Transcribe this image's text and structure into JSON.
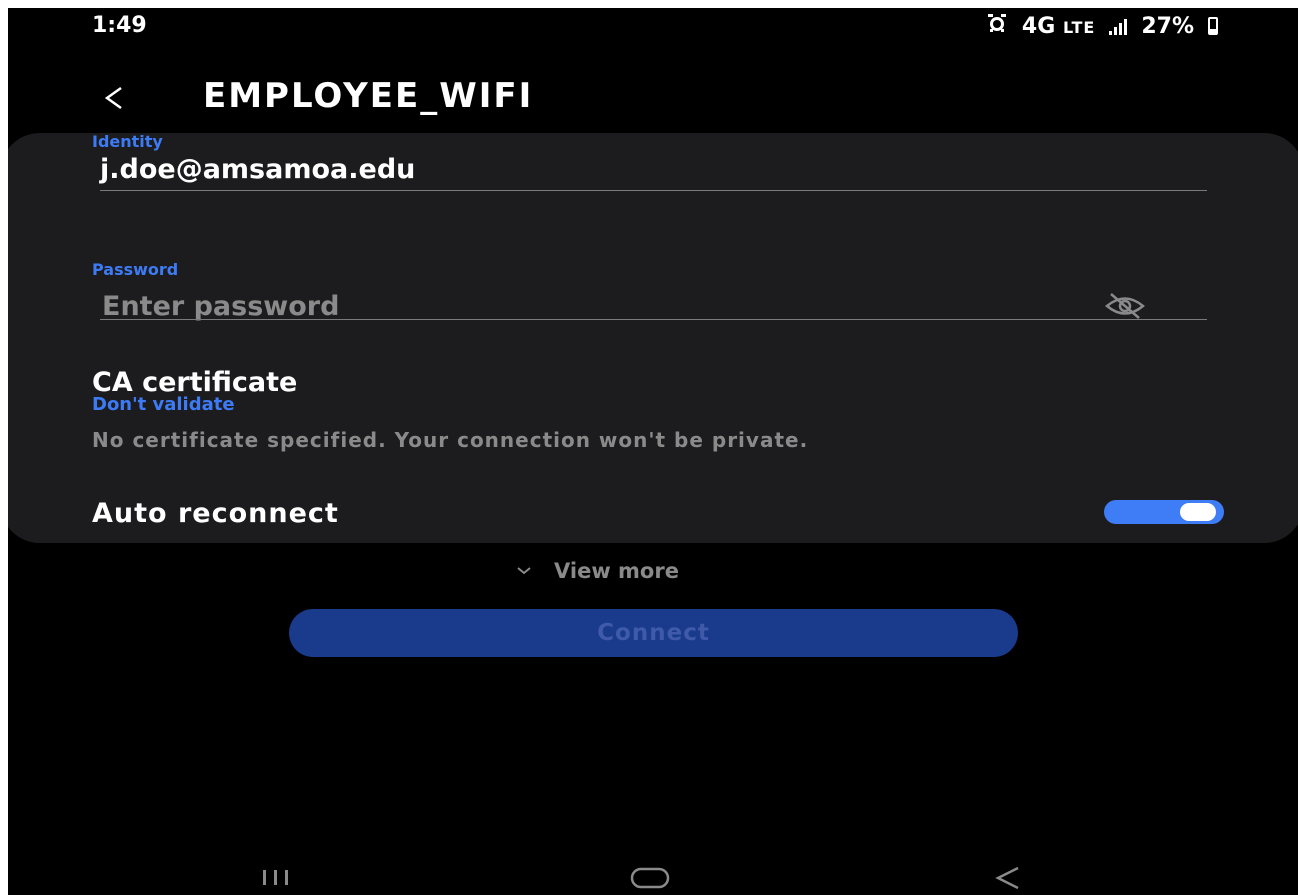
{
  "status_bar": {
    "time": "1:49",
    "network": "4G",
    "network_sub": "LTE",
    "battery": "27%"
  },
  "header": {
    "title": "EMPLOYEE_WIFI",
    "back_icon": "chevron-left-icon"
  },
  "identity": {
    "label": "Identity",
    "value": "j.doe@amsamoa.edu"
  },
  "password": {
    "label": "Password",
    "placeholder": "Enter password",
    "value": "",
    "visibility_icon": "eye-off-icon"
  },
  "ca_certificate": {
    "title": "CA certificate",
    "value": "Don't validate",
    "warning": "No certificate specified. Your connection won't be private."
  },
  "auto_reconnect": {
    "label": "Auto reconnect",
    "enabled": true
  },
  "view_more": {
    "label": "View more",
    "icon": "chevron-down-icon"
  },
  "connect": {
    "label": "Connect",
    "enabled": false
  },
  "nav_bar": {
    "recent_icon": "recent-apps-icon",
    "home_icon": "home-icon",
    "back_icon": "back-icon"
  },
  "colors": {
    "accent": "#3d7bf6",
    "background": "#000000",
    "card": "#1c1c1e",
    "button_disabled": "#1a3a8c"
  }
}
